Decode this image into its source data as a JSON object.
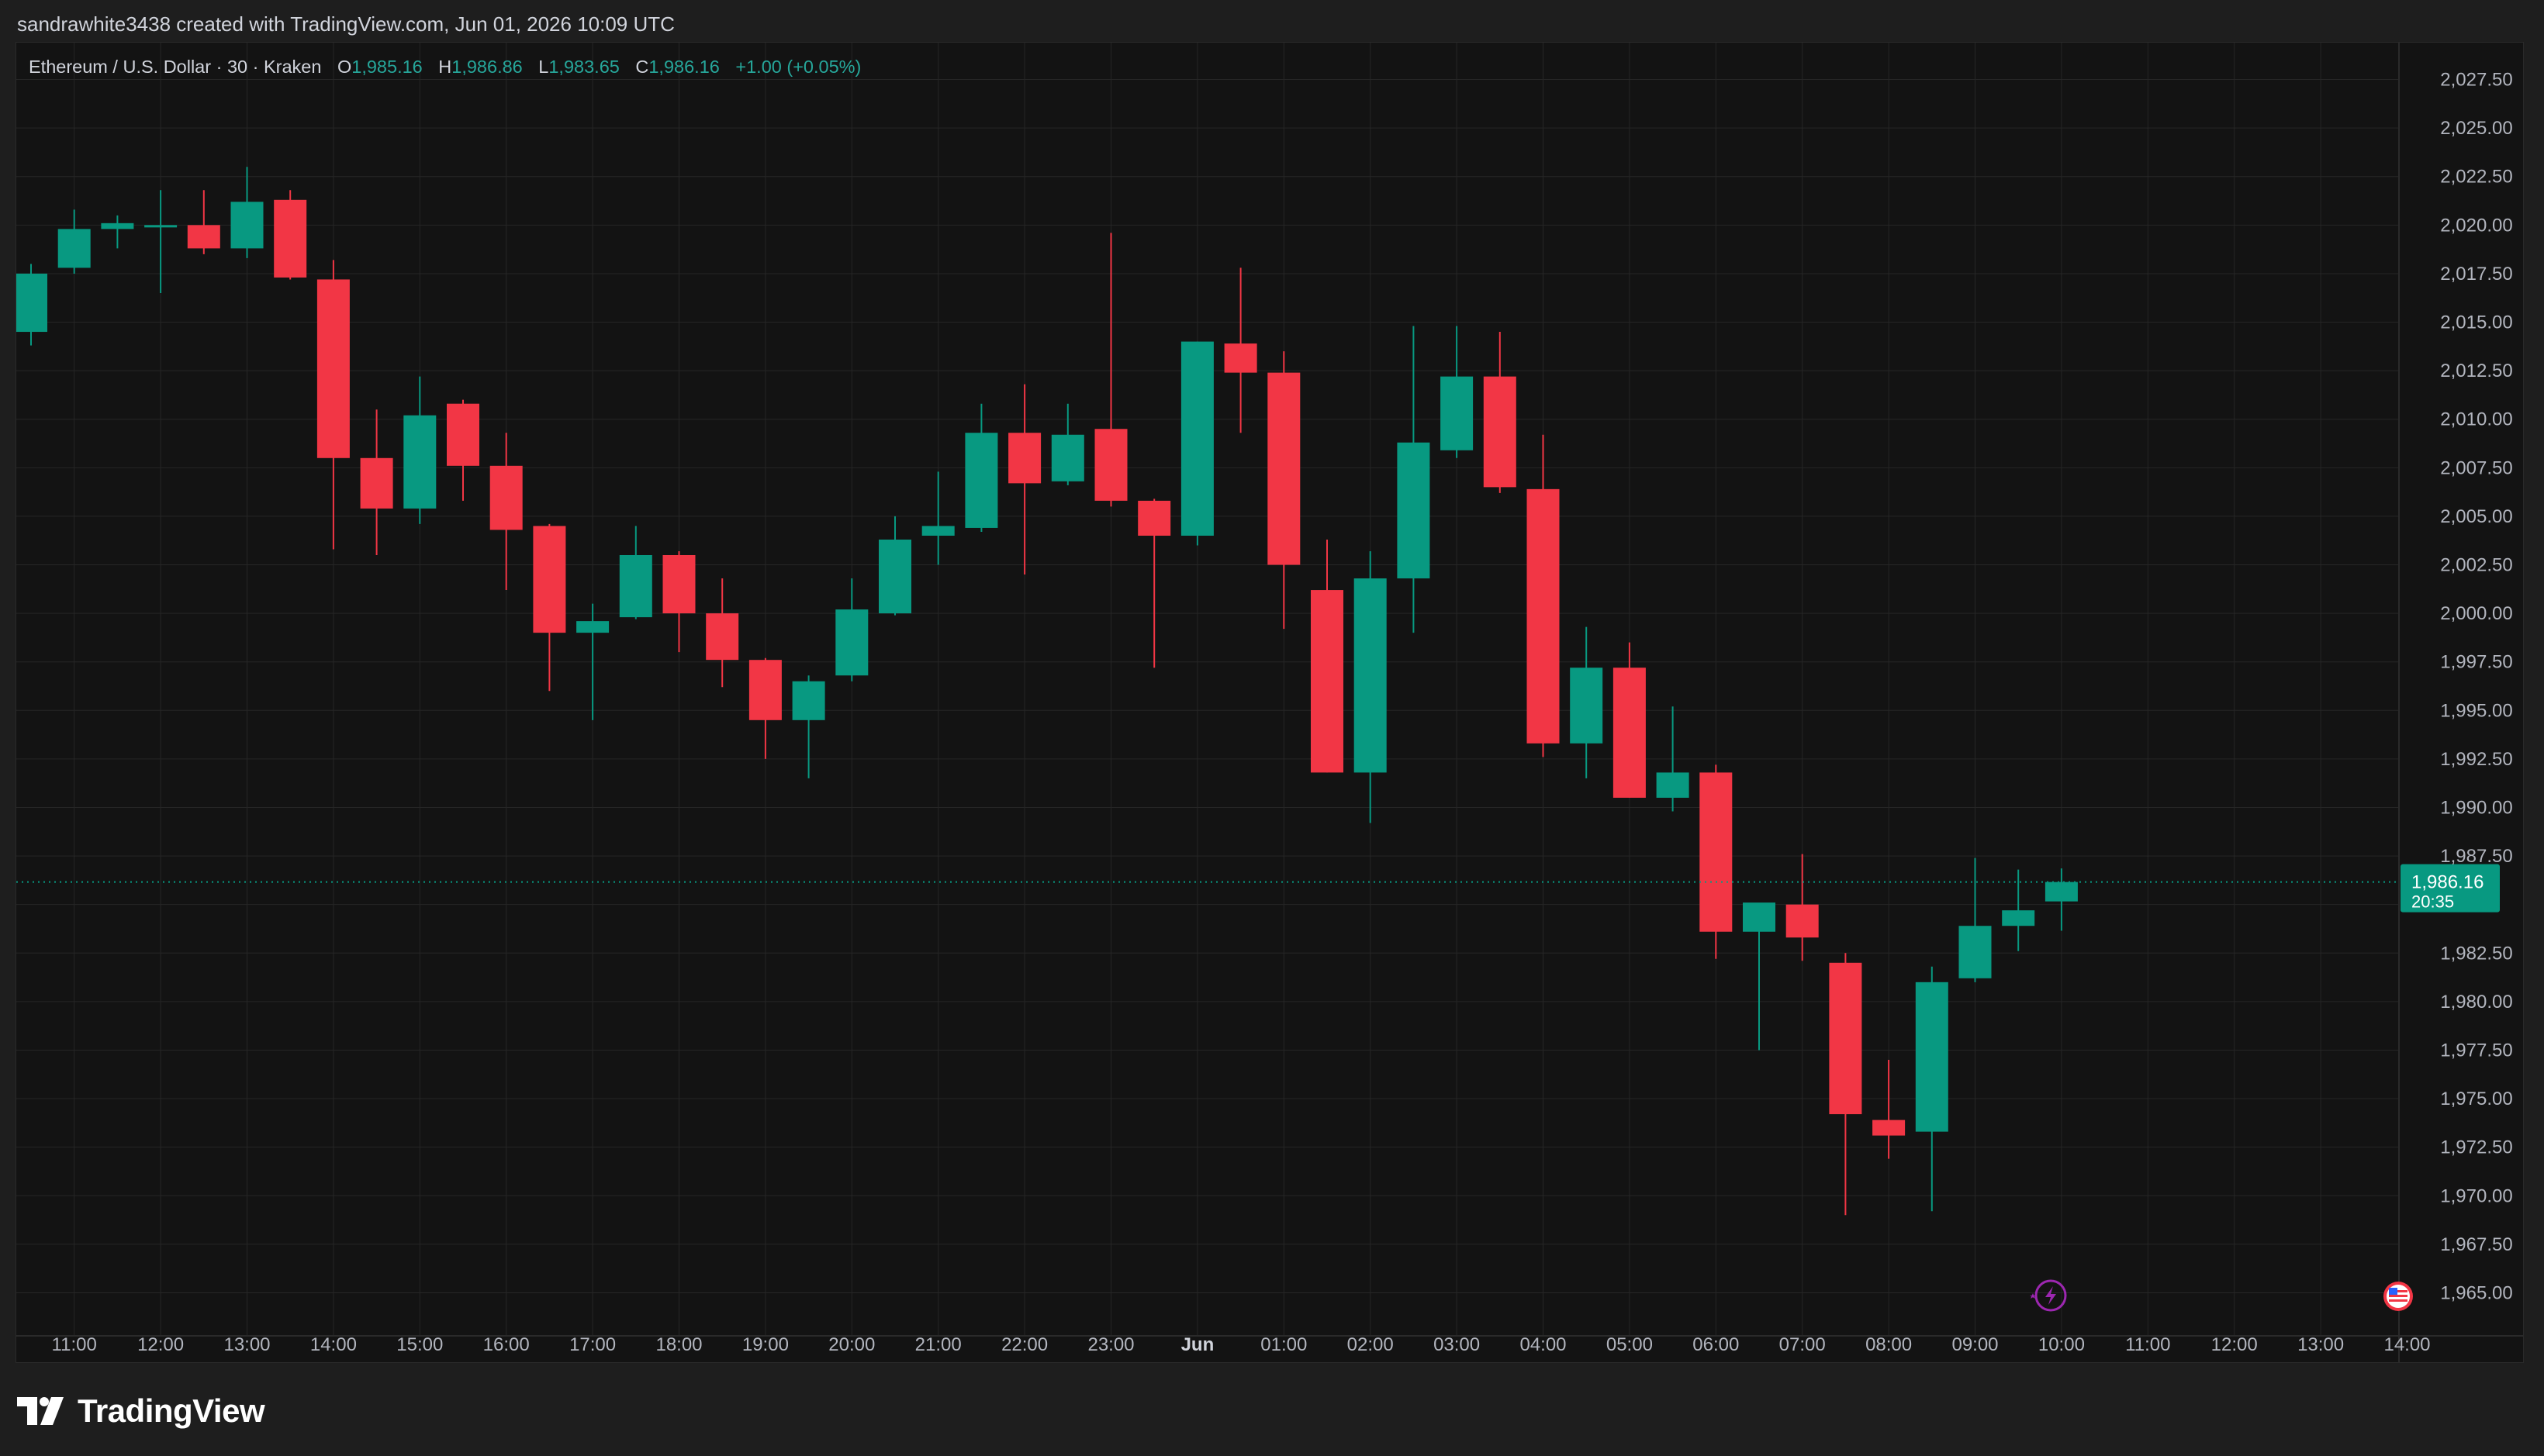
{
  "header": {
    "attribution": "sandrawhite3438 created with TradingView.com, Jun 01, 2026 10:09 UTC"
  },
  "legend": {
    "symbol": "Ethereum / U.S. Dollar · 30 · Kraken",
    "open_label": "O",
    "open": "1,985.16",
    "high_label": "H",
    "high": "1,986.86",
    "low_label": "L",
    "low": "1,983.65",
    "close_label": "C",
    "close": "1,986.16",
    "change": "+1.00 (+0.05%)"
  },
  "footer": {
    "brand": "TradingView"
  },
  "colors": {
    "up": "#089981",
    "down": "#f23645",
    "background": "#131313",
    "grid": "#262626",
    "text": "#b2b5be",
    "price_tag": "#089981"
  },
  "chart_data": {
    "type": "candlestick",
    "ylim": [
      1963.5,
      2029.0
    ],
    "y_ticks": [
      1965,
      1967.5,
      1970,
      1972.5,
      1975,
      1977.5,
      1980,
      1982.5,
      1985,
      1987.5,
      1990,
      1992.5,
      1995,
      1997.5,
      2000,
      2002.5,
      2005,
      2007.5,
      2010,
      2012.5,
      2015,
      2017.5,
      2020,
      2022.5,
      2025,
      2027.5
    ],
    "y_tick_labels": [
      "1,965.00",
      "1,967.50",
      "1,970.00",
      "1,972.50",
      "1,975.00",
      "1,977.50",
      "1,980.00",
      "1,982.50",
      "",
      "1,987.50",
      "1,990.00",
      "1,992.50",
      "1,995.00",
      "1,997.50",
      "2,000.00",
      "2,002.50",
      "2,005.00",
      "2,007.50",
      "2,010.00",
      "2,012.50",
      "2,015.00",
      "2,017.50",
      "2,020.00",
      "2,022.50",
      "2,025.00",
      "2,027.50"
    ],
    "x_tick_labels": [
      "11:00",
      "12:00",
      "13:00",
      "14:00",
      "15:00",
      "16:00",
      "17:00",
      "18:00",
      "19:00",
      "20:00",
      "21:00",
      "22:00",
      "23:00",
      "Jun",
      "01:00",
      "02:00",
      "03:00",
      "04:00",
      "05:00",
      "06:00",
      "07:00",
      "08:00",
      "09:00",
      "10:00",
      "11:00",
      "12:00",
      "13:00",
      "14:00"
    ],
    "x_tick_index": [
      1,
      3,
      5,
      7,
      9,
      11,
      13,
      15,
      17,
      19,
      21,
      23,
      25,
      27,
      29,
      31,
      33,
      35,
      37,
      39,
      41,
      43,
      45,
      47,
      49,
      51,
      53,
      55
    ],
    "candles": [
      {
        "o": 2014.5,
        "h": 2018.0,
        "l": 2013.8,
        "c": 2017.5
      },
      {
        "o": 2017.8,
        "h": 2020.8,
        "l": 2017.5,
        "c": 2019.8
      },
      {
        "o": 2019.8,
        "h": 2020.5,
        "l": 2018.8,
        "c": 2020.1
      },
      {
        "o": 2020.0,
        "h": 2021.8,
        "l": 2016.5,
        "c": 2020.0
      },
      {
        "o": 2020.0,
        "h": 2021.8,
        "l": 2018.5,
        "c": 2018.8
      },
      {
        "o": 2018.8,
        "h": 2023.0,
        "l": 2018.3,
        "c": 2021.2
      },
      {
        "o": 2021.3,
        "h": 2021.8,
        "l": 2017.2,
        "c": 2017.3
      },
      {
        "o": 2017.2,
        "h": 2018.2,
        "l": 2003.3,
        "c": 2008.0
      },
      {
        "o": 2008.0,
        "h": 2010.5,
        "l": 2003.0,
        "c": 2005.4
      },
      {
        "o": 2005.4,
        "h": 2012.2,
        "l": 2004.6,
        "c": 2010.2
      },
      {
        "o": 2010.8,
        "h": 2011.0,
        "l": 2005.8,
        "c": 2007.6
      },
      {
        "o": 2007.6,
        "h": 2009.3,
        "l": 2001.2,
        "c": 2004.3
      },
      {
        "o": 2004.5,
        "h": 2004.6,
        "l": 1996.0,
        "c": 1999.0
      },
      {
        "o": 1999.0,
        "h": 2000.5,
        "l": 1994.5,
        "c": 1999.6
      },
      {
        "o": 1999.8,
        "h": 2004.5,
        "l": 1999.7,
        "c": 2003.0
      },
      {
        "o": 2003.0,
        "h": 2003.2,
        "l": 1998.0,
        "c": 2000.0
      },
      {
        "o": 2000.0,
        "h": 2001.8,
        "l": 1996.2,
        "c": 1997.6
      },
      {
        "o": 1997.6,
        "h": 1997.7,
        "l": 1992.5,
        "c": 1994.5
      },
      {
        "o": 1994.5,
        "h": 1996.8,
        "l": 1991.5,
        "c": 1996.5
      },
      {
        "o": 1996.8,
        "h": 2001.8,
        "l": 1996.5,
        "c": 2000.2
      },
      {
        "o": 2000.0,
        "h": 2005.0,
        "l": 1999.9,
        "c": 2003.8
      },
      {
        "o": 2004.0,
        "h": 2007.3,
        "l": 2002.5,
        "c": 2004.5
      },
      {
        "o": 2004.4,
        "h": 2010.8,
        "l": 2004.2,
        "c": 2009.3
      },
      {
        "o": 2009.3,
        "h": 2011.8,
        "l": 2002.0,
        "c": 2006.7
      },
      {
        "o": 2006.8,
        "h": 2010.8,
        "l": 2006.6,
        "c": 2009.2
      },
      {
        "o": 2009.5,
        "h": 2019.6,
        "l": 2005.5,
        "c": 2005.8
      },
      {
        "o": 2005.8,
        "h": 2005.9,
        "l": 1997.2,
        "c": 2004.0
      },
      {
        "o": 2004.0,
        "h": 2014.0,
        "l": 2003.5,
        "c": 2014.0
      },
      {
        "o": 2013.9,
        "h": 2017.8,
        "l": 2009.3,
        "c": 2012.4
      },
      {
        "o": 2012.4,
        "h": 2013.5,
        "l": 1999.2,
        "c": 2002.5
      },
      {
        "o": 2001.2,
        "h": 2003.8,
        "l": 1991.8,
        "c": 1991.8
      },
      {
        "o": 1991.8,
        "h": 2003.2,
        "l": 1989.2,
        "c": 2001.8
      },
      {
        "o": 2001.8,
        "h": 2014.8,
        "l": 1999.0,
        "c": 2008.8
      },
      {
        "o": 2008.4,
        "h": 2014.8,
        "l": 2008.0,
        "c": 2012.2
      },
      {
        "o": 2012.2,
        "h": 2014.5,
        "l": 2006.2,
        "c": 2006.5
      },
      {
        "o": 2006.4,
        "h": 2009.2,
        "l": 1992.6,
        "c": 1993.3
      },
      {
        "o": 1993.3,
        "h": 1999.3,
        "l": 1991.5,
        "c": 1997.2
      },
      {
        "o": 1997.2,
        "h": 1998.5,
        "l": 1990.5,
        "c": 1990.5
      },
      {
        "o": 1990.5,
        "h": 1995.2,
        "l": 1989.8,
        "c": 1991.8
      },
      {
        "o": 1991.8,
        "h": 1992.2,
        "l": 1982.2,
        "c": 1983.6
      },
      {
        "o": 1983.6,
        "h": 1985.0,
        "l": 1977.5,
        "c": 1985.1
      },
      {
        "o": 1985.0,
        "h": 1987.6,
        "l": 1982.1,
        "c": 1983.3
      },
      {
        "o": 1982.0,
        "h": 1982.5,
        "l": 1969.0,
        "c": 1974.2
      },
      {
        "o": 1973.9,
        "h": 1977.0,
        "l": 1971.9,
        "c": 1973.1
      },
      {
        "o": 1973.3,
        "h": 1981.8,
        "l": 1969.2,
        "c": 1981.0
      },
      {
        "o": 1981.2,
        "h": 1987.4,
        "l": 1981.0,
        "c": 1983.9
      },
      {
        "o": 1983.9,
        "h": 1986.8,
        "l": 1982.6,
        "c": 1984.7
      },
      {
        "o": 1985.16,
        "h": 1986.86,
        "l": 1983.65,
        "c": 1986.16
      }
    ],
    "last_price": "1,986.16",
    "countdown": "20:35",
    "grid": true
  }
}
